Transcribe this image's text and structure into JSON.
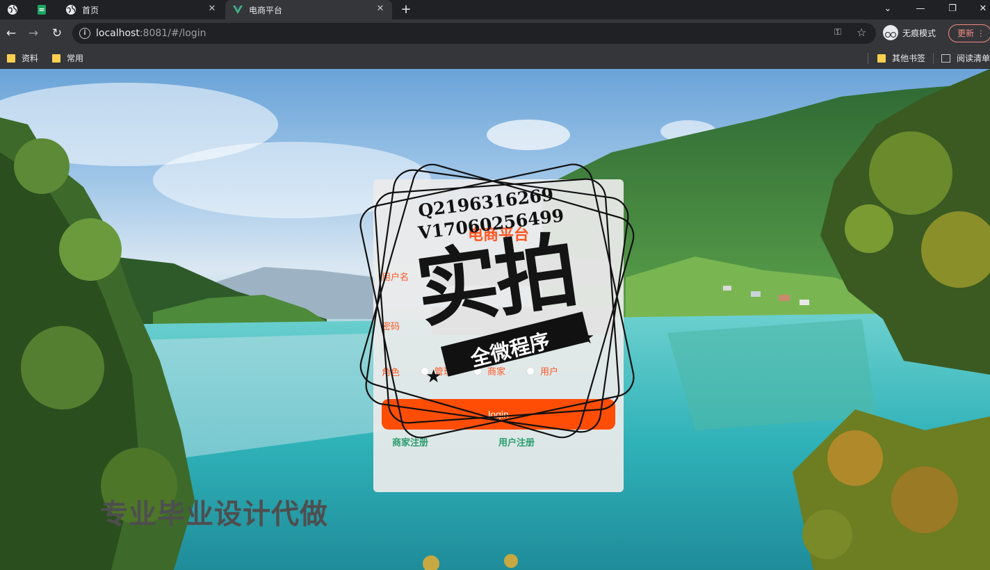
{
  "browser": {
    "tabs": [
      {
        "label": "",
        "icon": "globe-icon"
      },
      {
        "label": "",
        "icon": "sheets-icon"
      },
      {
        "label": "首页",
        "icon": "globe-icon"
      },
      {
        "label": "电商平台",
        "icon": "vue-icon"
      }
    ],
    "address": {
      "host": "localhost",
      "rest": ":8081/#/login"
    },
    "incognito_label": "无痕模式",
    "update_label": "更新",
    "bookmarks": [
      "资料",
      "常用"
    ],
    "bookmarks_right": [
      "其他书签",
      "阅读清单"
    ]
  },
  "login": {
    "title": "电商平台",
    "username_label": "用户名",
    "password_label": "密码",
    "role_label": "角色",
    "roles": [
      "管理",
      "商家",
      "用户"
    ],
    "submit_label": "login",
    "links": [
      "商家注册",
      "用户注册"
    ]
  },
  "watermark": {
    "line1": "Q2196316269",
    "line2": "V17060256499",
    "big": "实拍",
    "ribbon": "全微程序"
  },
  "overlay_text": "专业毕业设计代做",
  "colors": {
    "accent": "#ff5722",
    "button": "#ff4d06",
    "link": "#2a9d6f"
  }
}
